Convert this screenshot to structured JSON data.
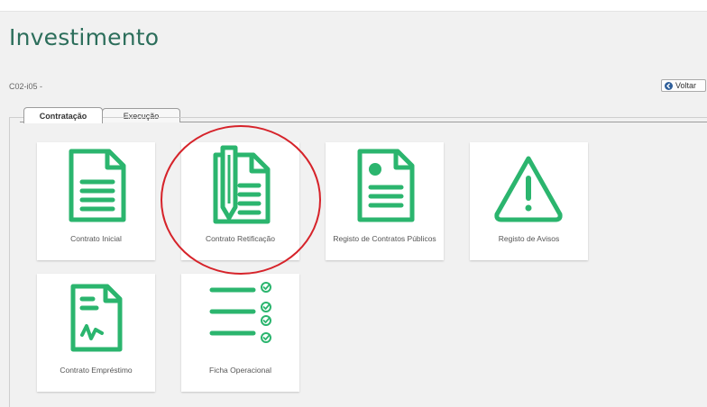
{
  "header": {
    "title": "Investimento",
    "code": "C02-i05 -",
    "back_label": "Voltar"
  },
  "tabs": [
    {
      "label": "Contratação",
      "active": true
    },
    {
      "label": "Execução",
      "active": false
    }
  ],
  "tiles": [
    {
      "label": "Contrato Inicial",
      "icon": "document-icon"
    },
    {
      "label": "Contrato Retificação",
      "icon": "document-pen-icon"
    },
    {
      "label": "Registo de Contratos Públicos",
      "icon": "document-dot-icon"
    },
    {
      "label": "Registo de Avisos",
      "icon": "warning-icon"
    },
    {
      "label": "Contrato Empréstimo",
      "icon": "loan-document-icon"
    },
    {
      "label": "Ficha Operacional",
      "icon": "checklist-icon"
    }
  ],
  "colors": {
    "accent": "#2bb56e",
    "title": "#2c6e5b",
    "annotation": "#d6232a"
  }
}
